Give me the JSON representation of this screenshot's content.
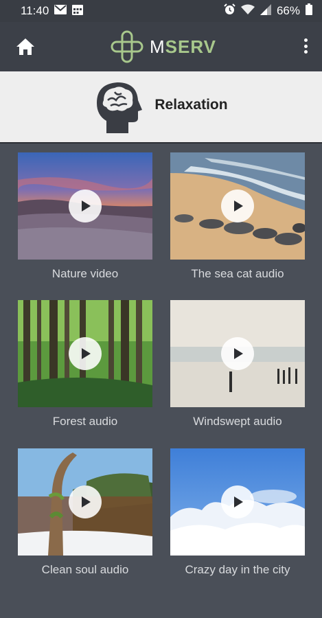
{
  "status_bar": {
    "time": "11:40",
    "battery": "66%",
    "icons": [
      "mail-icon",
      "calendar-icon",
      "alarm-icon",
      "wifi-icon",
      "signal-icon",
      "battery-icon"
    ]
  },
  "app_bar": {
    "brand_prefix": "M",
    "brand_suffix": "SERV",
    "home_icon": "home-icon",
    "menu_icon": "more-vert-icon"
  },
  "category": {
    "title": "Relaxation",
    "icon": "head-brain-icon"
  },
  "items": [
    {
      "title": "Nature video",
      "scene": "sunset-heather"
    },
    {
      "title": "The sea cat audio",
      "scene": "beach-rocks"
    },
    {
      "title": "Forest audio",
      "scene": "forest"
    },
    {
      "title": "Windswept audio",
      "scene": "misty-water"
    },
    {
      "title": "Clean soul audio",
      "scene": "winter-tree"
    },
    {
      "title": "Crazy day in the city",
      "scene": "blue-sky-clouds"
    }
  ],
  "colors": {
    "background": "#4a4f58",
    "app_bar": "#3c4048",
    "status_bar": "#393d44",
    "brand_accent": "#a8c88c",
    "category_bg": "#eeeeee"
  }
}
